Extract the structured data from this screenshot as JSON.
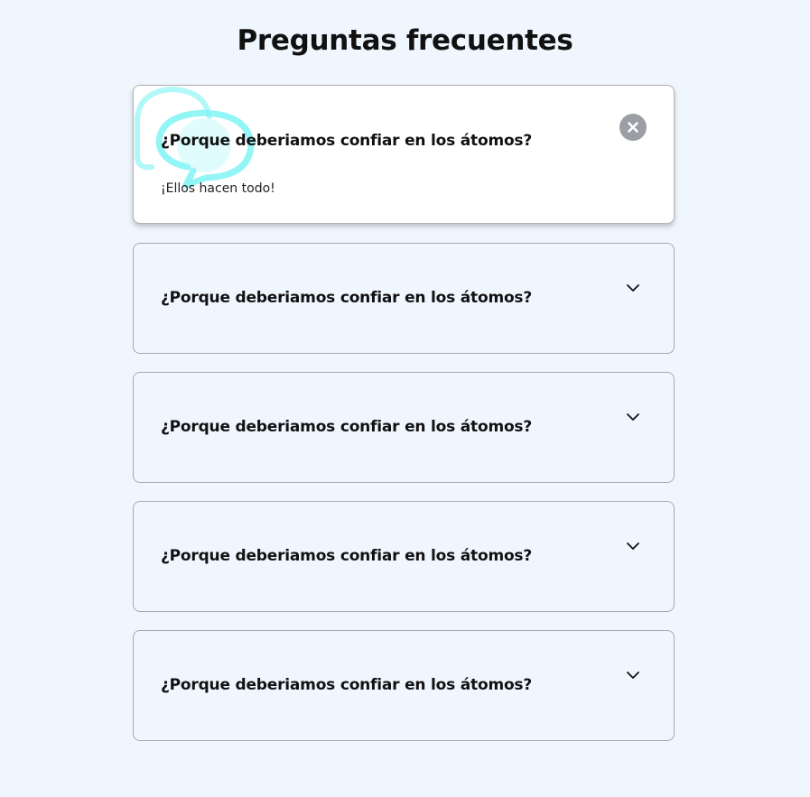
{
  "page": {
    "title": "Preguntas frecuentes"
  },
  "colors": {
    "background": "#f0f6fe",
    "card_open_background": "#ffffff",
    "card_border": "#a6a9b0",
    "close_button": "#9b9fa5",
    "accent_icon": "#7ff3f5",
    "text": "#111111"
  },
  "faq": {
    "items": [
      {
        "question": "¿Porque deberiamos confiar en los átomos?",
        "answer": "¡Ellos hacen todo!",
        "state": "open",
        "toggle_icon": "close-icon",
        "decoration_icon": "chat-bubbles-icon"
      },
      {
        "question": "¿Porque deberiamos confiar en los átomos?",
        "state": "collapsed",
        "toggle_icon": "chevron-down-icon"
      },
      {
        "question": "¿Porque deberiamos confiar en los átomos?",
        "state": "collapsed",
        "toggle_icon": "chevron-down-icon"
      },
      {
        "question": "¿Porque deberiamos confiar en los átomos?",
        "state": "collapsed",
        "toggle_icon": "chevron-down-icon"
      },
      {
        "question": "¿Porque deberiamos confiar en los átomos?",
        "state": "collapsed",
        "toggle_icon": "chevron-down-icon"
      }
    ]
  }
}
